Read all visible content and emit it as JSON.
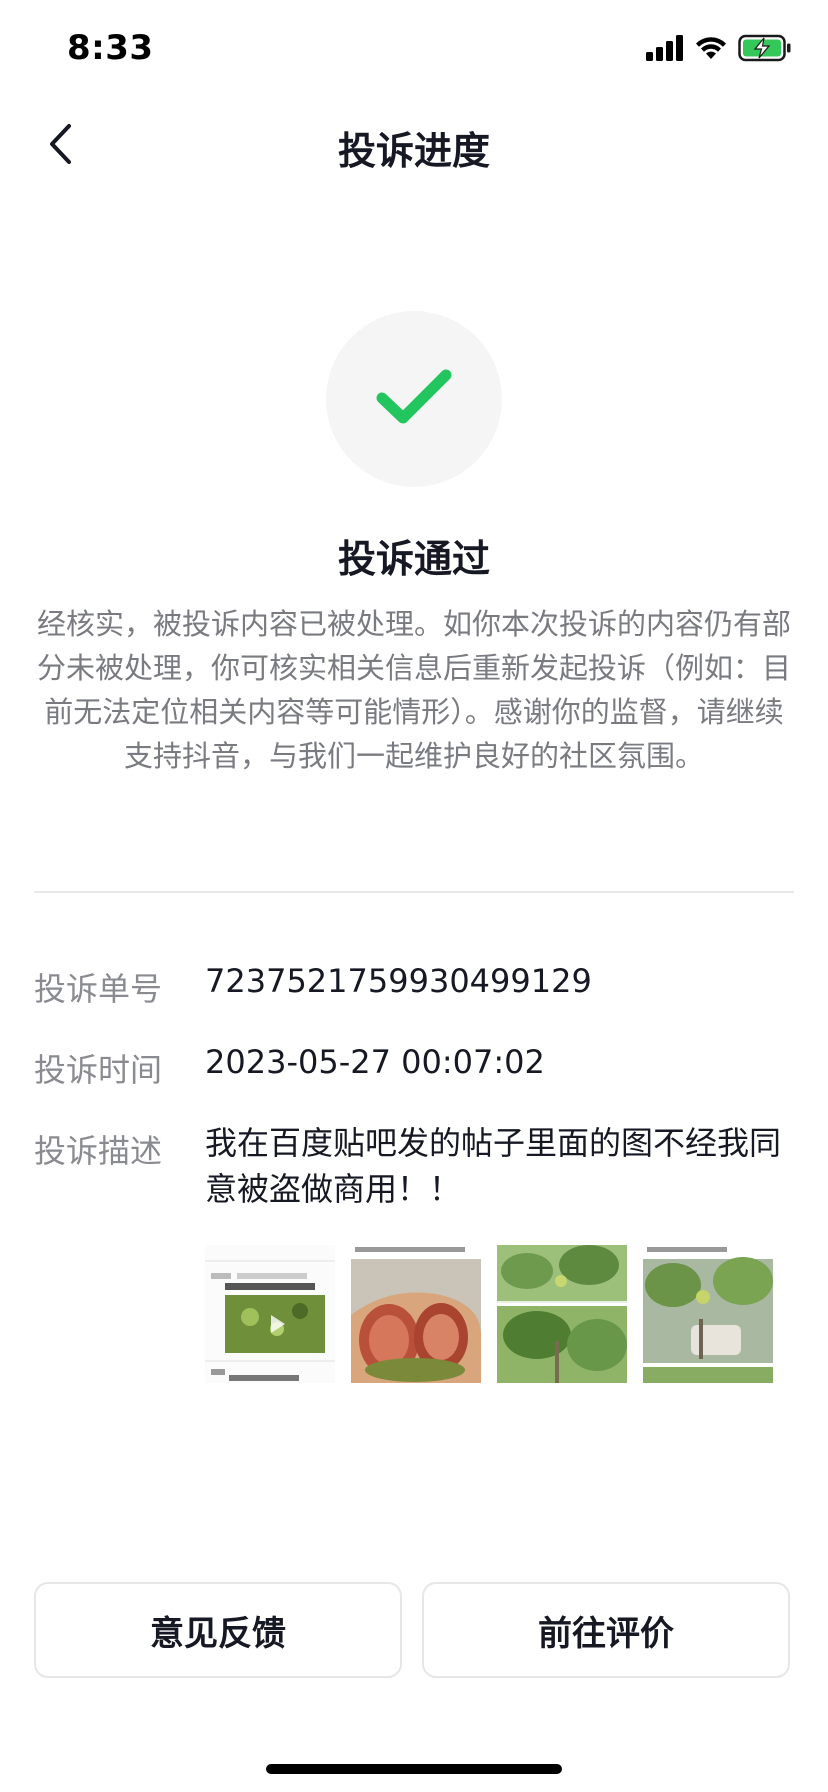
{
  "status_bar": {
    "time": "8:33"
  },
  "nav": {
    "title": "投诉进度"
  },
  "result": {
    "title": "投诉通过",
    "description": "经核实，被投诉内容已被处理。如你本次投诉的内容仍有部分未被处理，你可核实相关信息后重新发起投诉（例如：目前无法定位相关内容等可能情形）。感谢你的监督，请继续支持抖音，与我们一起维护良好的社区氛围。",
    "icon": "check-icon",
    "accent_color": "#22c55e"
  },
  "details": {
    "order_label": "投诉单号",
    "order_value": "7237521759930499129",
    "time_label": "投诉时间",
    "time_value": "2023-05-27 00:07:02",
    "desc_label": "投诉描述",
    "desc_value": "我在百度贴吧发的帖子里面的图不经我同意被盗做商用！！"
  },
  "buttons": {
    "feedback": "意见反馈",
    "rate": "前往评价"
  }
}
